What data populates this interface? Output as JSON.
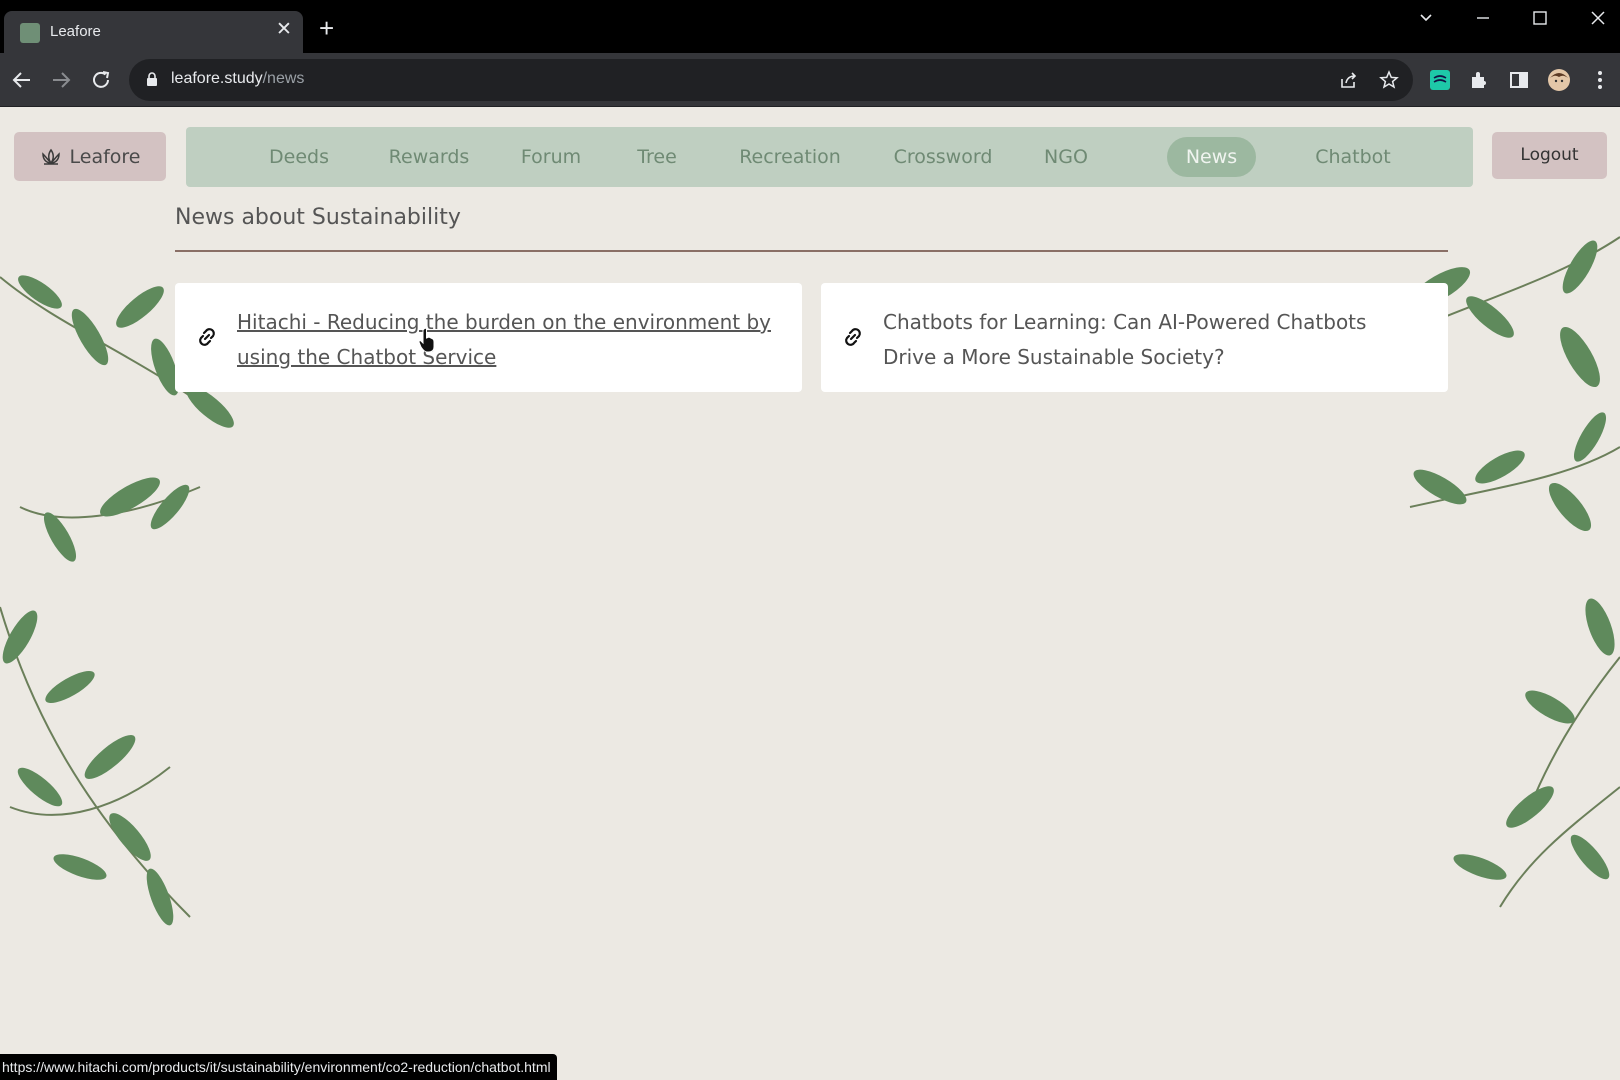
{
  "browser": {
    "tab_title": "Leafore",
    "url_domain": "leafore.study",
    "url_path": "/news",
    "status_url": "https://www.hitachi.com/products/it/sustainability/environment/co2-reduction/chatbot.html"
  },
  "header": {
    "brand": "Leafore",
    "logout": "Logout",
    "nav": [
      {
        "label": "Deeds"
      },
      {
        "label": "Rewards"
      },
      {
        "label": "Forum"
      },
      {
        "label": "Tree"
      },
      {
        "label": "Recreation"
      },
      {
        "label": "Crossword"
      },
      {
        "label": "NGO"
      },
      {
        "label": "News",
        "active": true
      },
      {
        "label": "Chatbot"
      }
    ]
  },
  "main": {
    "title": "News about Sustainability",
    "articles": [
      {
        "title": "Hitachi - Reducing the burden on the environment by using the Chatbot Service"
      },
      {
        "title": "Chatbots for Learning: Can AI-Powered Chatbots Drive a More Sustainable Society?"
      }
    ]
  },
  "colors": {
    "page_bg": "#ece9e3",
    "nav_bg": "#bfcfc1",
    "nav_active": "#9cb8a0",
    "button_bg": "#d3c2c2",
    "rule": "#8a6f66"
  }
}
